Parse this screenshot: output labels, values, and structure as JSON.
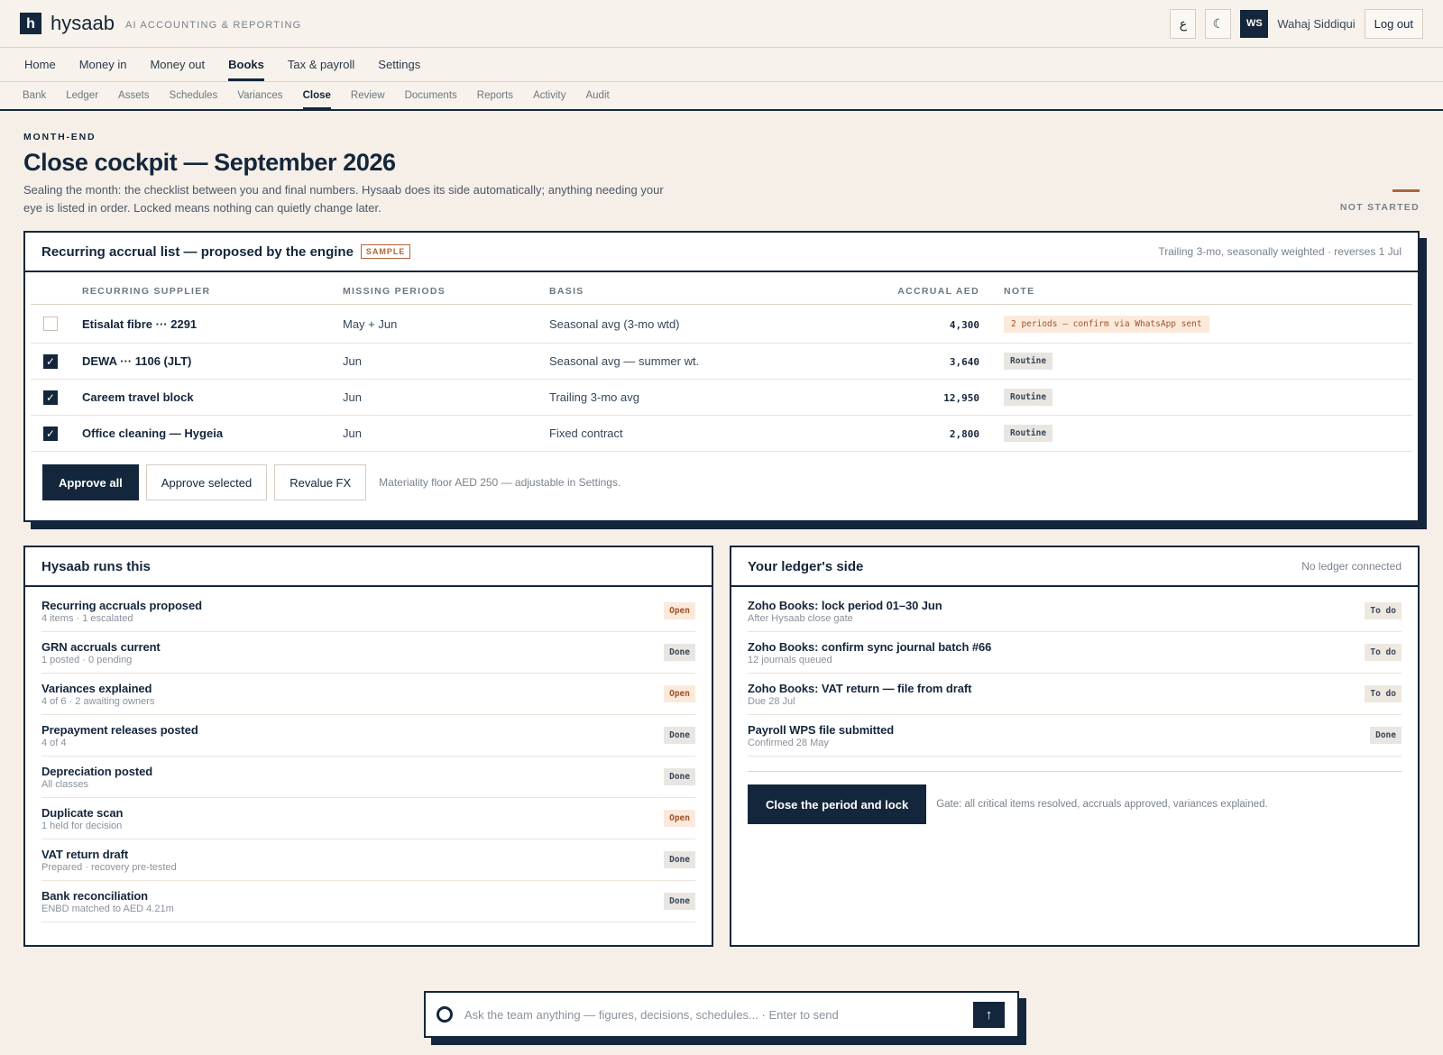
{
  "app": {
    "logo_letter": "h",
    "name": "hysaab",
    "tagline": "AI ACCOUNTING & REPORTING"
  },
  "topbar": {
    "lang_label": "ع",
    "theme_label": "☾",
    "avatar_initials": "WS",
    "user_name": "Wahaj Siddiqui",
    "logout_label": "Log out"
  },
  "nav": {
    "main": [
      "Home",
      "Money in",
      "Money out",
      "Books",
      "Tax & payroll",
      "Settings"
    ],
    "main_active": "Books",
    "sub": [
      "Bank",
      "Ledger",
      "Assets",
      "Schedules",
      "Variances",
      "Close",
      "Review",
      "Documents",
      "Reports",
      "Activity",
      "Audit"
    ],
    "sub_active": "Close"
  },
  "header": {
    "eyebrow": "MONTH-END",
    "title": "Close cockpit — September 2026",
    "description": "Sealing the month: the checklist between you and final numbers. Hysaab does its side automatically; anything needing your eye is listed in order. Locked means nothing can quietly change later.",
    "status": "NOT STARTED",
    "status_color": "#b0643a"
  },
  "accruals": {
    "title": "Recurring accrual list — proposed by the engine",
    "badge": "SAMPLE",
    "meta": "Trailing 3-mo, seasonally weighted · reverses 1 Jul",
    "columns": {
      "supplier": "RECURRING SUPPLIER",
      "missing": "MISSING PERIODS",
      "basis": "BASIS",
      "accrual": "ACCRUAL AED",
      "note": "NOTE"
    },
    "rows": [
      {
        "checked": false,
        "supplier": "Etisalat fibre ··· 2291",
        "missing": "May + Jun",
        "basis": "Seasonal avg (3-mo wtd)",
        "accrual": "4,300",
        "note": "2 periods — confirm via WhatsApp sent",
        "note_type": "warn"
      },
      {
        "checked": true,
        "supplier": "DEWA ··· 1106 (JLT)",
        "missing": "Jun",
        "basis": "Seasonal avg — summer wt.",
        "accrual": "3,640",
        "note": "Routine",
        "note_type": "routine"
      },
      {
        "checked": true,
        "supplier": "Careem travel block",
        "missing": "Jun",
        "basis": "Trailing 3-mo avg",
        "accrual": "12,950",
        "note": "Routine",
        "note_type": "routine"
      },
      {
        "checked": true,
        "supplier": "Office cleaning — Hygeia",
        "missing": "Jun",
        "basis": "Fixed contract",
        "accrual": "2,800",
        "note": "Routine",
        "note_type": "routine"
      }
    ],
    "approve_all": "Approve all",
    "approve_selected": "Approve selected",
    "revalue_fx": "Revalue FX",
    "hint": "Materiality floor AED 250 — adjustable in Settings."
  },
  "hysaab_side": {
    "title": "Hysaab runs this",
    "items": [
      {
        "title": "Recurring accruals proposed",
        "sub": "4 items · 1 escalated",
        "status": "Open"
      },
      {
        "title": "GRN accruals current",
        "sub": "1 posted · 0 pending",
        "status": "Done"
      },
      {
        "title": "Variances explained",
        "sub": "4 of 6 · 2 awaiting owners",
        "status": "Open"
      },
      {
        "title": "Prepayment releases posted",
        "sub": "4 of 4",
        "status": "Done"
      },
      {
        "title": "Depreciation posted",
        "sub": "All classes",
        "status": "Done"
      },
      {
        "title": "Duplicate scan",
        "sub": "1 held for decision",
        "status": "Open"
      },
      {
        "title": "VAT return draft",
        "sub": "Prepared · recovery pre-tested",
        "status": "Done"
      },
      {
        "title": "Bank reconciliation",
        "sub": "ENBD matched to AED 4.21m",
        "status": "Done"
      }
    ]
  },
  "ledger_side": {
    "title": "Your ledger's side",
    "meta": "No ledger connected",
    "items": [
      {
        "title": "Zoho Books: lock period 01–30 Jun",
        "sub": "After Hysaab close gate",
        "status": "To do"
      },
      {
        "title": "Zoho Books: confirm sync journal batch #66",
        "sub": "12 journals queued",
        "status": "To do"
      },
      {
        "title": "Zoho Books: VAT return — file from draft",
        "sub": "Due 28 Jul",
        "status": "To do"
      },
      {
        "title": "Payroll WPS file submitted",
        "sub": "Confirmed 28 May",
        "status": "Done"
      }
    ],
    "close_button": "Close the period and lock",
    "gate_text": "Gate: all critical items resolved, accruals approved, variances explained."
  },
  "ask": {
    "placeholder": "Ask the team anything — figures, decisions, schedules...  ·  Enter to send",
    "send_label": "↑"
  }
}
